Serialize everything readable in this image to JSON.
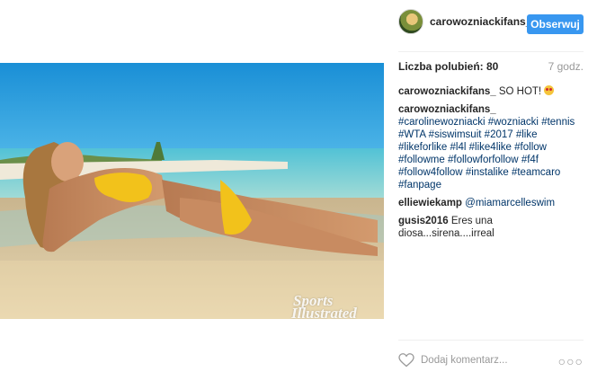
{
  "post": {
    "username": "carowozniackifans_",
    "follow_label": "Obserwuj",
    "likes_label": "Liczba polubień: 80",
    "time": "7 godz.",
    "watermark": {
      "line1": "Sports",
      "line2": "Illustrated"
    }
  },
  "comments": [
    {
      "user": "carowozniackifans_",
      "text": " SO HOT! ",
      "emoji": "heart-eyes-emoji"
    },
    {
      "user": "carowozniackifans_",
      "text": " ",
      "tags": [
        "#carolinewozniacki",
        "#wozniacki",
        "#tennis",
        "#WTA",
        "#siswimsuit",
        "#2017",
        "#like",
        "#likeforlike",
        "#l4l",
        "#like4like",
        "#follow",
        "#followme",
        "#followforfollow",
        "#f4f",
        "#follow4follow",
        "#instalike",
        "#teamcaro",
        "#fanpage"
      ]
    },
    {
      "user": "elliewiekamp",
      "text": " ",
      "mention": "@miamarcelleswim"
    },
    {
      "user": "gusis2016",
      "text": " Eres una diosa...sirena....irreal"
    }
  ],
  "footer": {
    "placeholder": "Dodaj komentarz...",
    "more": "○○○"
  },
  "colors": {
    "follow_button": "#3897f0",
    "hashtag": "#003569"
  }
}
